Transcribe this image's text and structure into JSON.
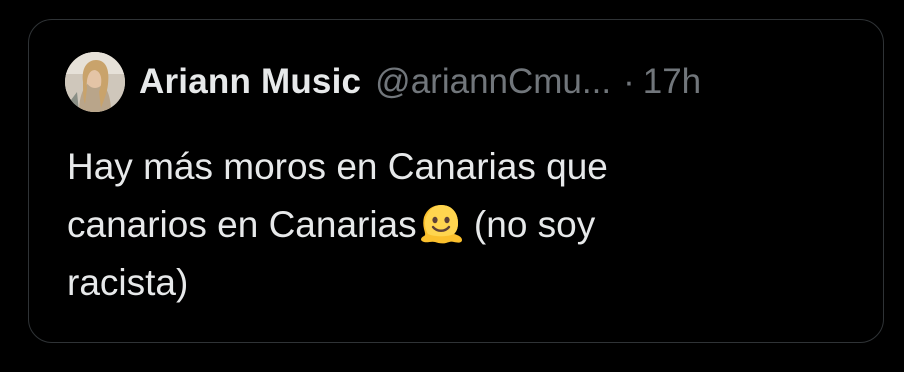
{
  "quoted_tweet": {
    "author": {
      "display_name": "Ariann Music",
      "handle": "@ariannCmu...",
      "avatar_icon": "profile-photo"
    },
    "separator": "·",
    "time": "17h",
    "text": {
      "line1": "Hay más moros en Canarias que",
      "line2_start": "canarios en Canarias",
      "emoji": "melting-face-emoji",
      "line2_end": " (no soy",
      "line3": "racista)"
    }
  },
  "colors": {
    "background": "#000000",
    "border": "#2f3336",
    "primary_text": "#e7e9ea",
    "secondary_text": "#71767b"
  }
}
